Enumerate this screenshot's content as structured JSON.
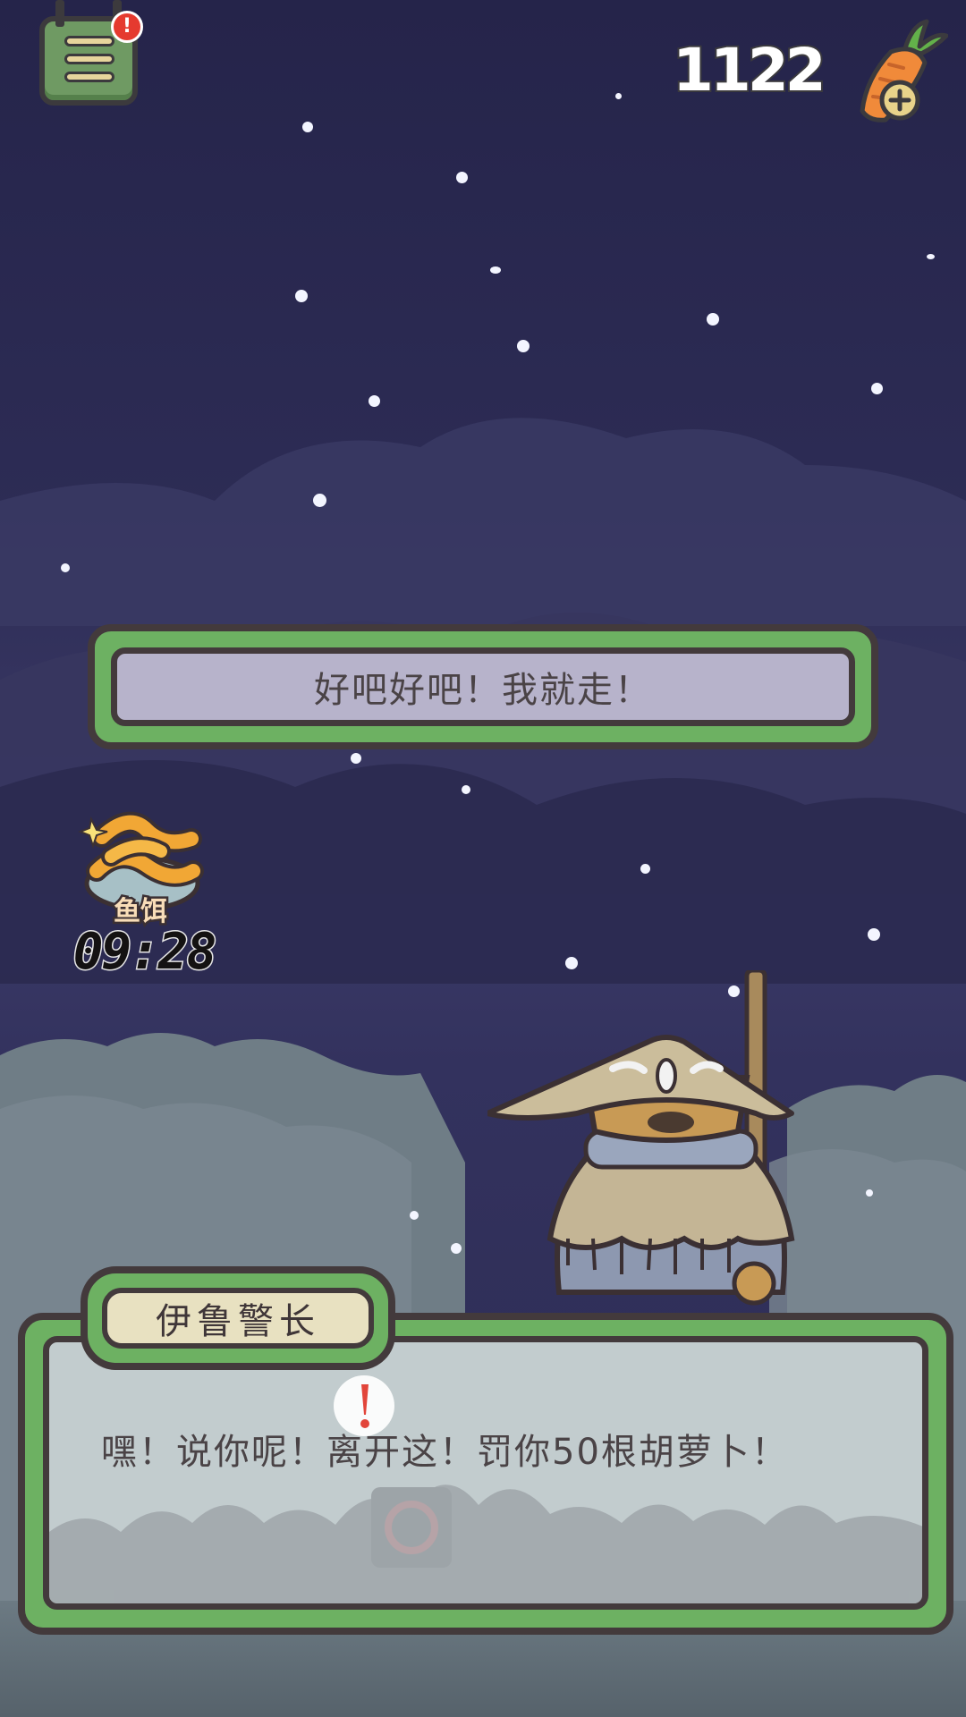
{
  "header": {
    "menu_badge": "!",
    "carrot_count": "1122"
  },
  "top_dialog": {
    "text": "好吧好吧！我就走！"
  },
  "bait": {
    "label": "鱼饵",
    "timer": "09:28"
  },
  "dialog": {
    "speaker": "伊鲁警长",
    "text": "嘿！说你呢！离开这！罚你50根胡萝卜！"
  },
  "icons": {
    "menu": "menu-list-icon",
    "carrot": "carrot-plus-icon",
    "bait": "worm-bait-icon",
    "alert": "exclamation-bubble-icon"
  },
  "colors": {
    "sky": "#2d2c55",
    "frame_green": "#6db162",
    "frame_dark": "#433a3c",
    "badge_red": "#e53a2f"
  }
}
